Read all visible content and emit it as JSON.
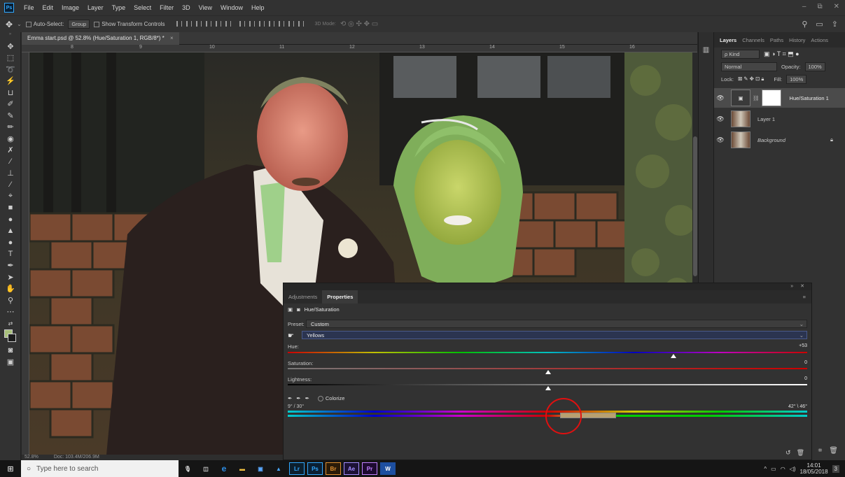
{
  "menubar": {
    "logo": "Ps",
    "items": [
      "File",
      "Edit",
      "Image",
      "Layer",
      "Type",
      "Select",
      "Filter",
      "3D",
      "View",
      "Window",
      "Help"
    ],
    "window_controls": [
      "–",
      "⧉",
      "✕"
    ]
  },
  "options": {
    "auto_select": "Auto-Select:",
    "group": "Group",
    "show_transform": "Show Transform Controls",
    "mode_3d": "3D Mode:"
  },
  "document": {
    "tab_title": "Emma start.psd @ 52.8% (Hue/Saturation 1, RGB/8*) *",
    "ruler_numbers": [
      "8",
      "9",
      "10",
      "11",
      "12",
      "13",
      "14",
      "15",
      "16"
    ],
    "zoom": "52.8%",
    "doc_info": "Doc: 103.4M/206.9M"
  },
  "layers_panel": {
    "tabs": [
      "Layers",
      "Channels",
      "Paths",
      "History",
      "Actions"
    ],
    "kind": "ρ Kind",
    "blend_mode": "Normal",
    "opacity_label": "Opacity:",
    "opacity": "100%",
    "lock_label": "Lock:",
    "fill_label": "Fill:",
    "fill": "100%",
    "layers": [
      {
        "name": "Hue/Saturation 1"
      },
      {
        "name": "Layer 1"
      },
      {
        "name": "Background"
      }
    ]
  },
  "properties": {
    "tabs": [
      "Adjustments",
      "Properties"
    ],
    "title": "Hue/Saturation",
    "preset_label": "Preset:",
    "preset": "Custom",
    "channel": "Yellows",
    "hue_label": "Hue:",
    "hue_value": "+53",
    "saturation_label": "Saturation:",
    "saturation_value": "0",
    "lightness_label": "Lightness:",
    "lightness_value": "0",
    "colorize": "Colorize",
    "range_left": "9° / 30°",
    "range_right": "42° \\ 46°",
    "hue_fraction": 0.74,
    "sat_fraction": 0.5,
    "light_fraction": 0.5
  },
  "taskbar": {
    "search_placeholder": "Type here to search",
    "apps": [
      "Lr",
      "Ps",
      "Br",
      "Ae",
      "Pr",
      "W"
    ],
    "time": "14:01",
    "date": "18/05/2018",
    "notif": "3"
  }
}
